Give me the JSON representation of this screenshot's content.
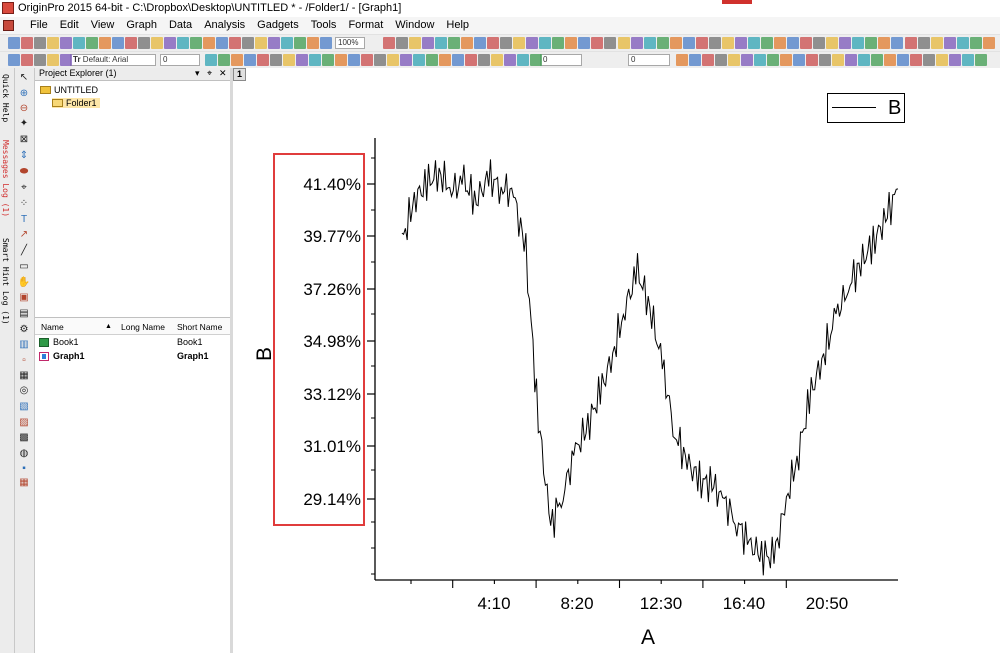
{
  "titlebar": {
    "title": "OriginPro 2015 64-bit - C:\\Dropbox\\Desktop\\UNTITLED * - /Folder1/ - [Graph1]"
  },
  "menu": [
    "File",
    "Edit",
    "View",
    "Graph",
    "Data",
    "Analysis",
    "Gadgets",
    "Tools",
    "Format",
    "Window",
    "Help"
  ],
  "toolbar": {
    "zoom": "100%",
    "font_name": "Default: Arial",
    "font_size": "0",
    "line_width": "0",
    "border_width": "0",
    "pattern_width": "0"
  },
  "left_rail": {
    "quick_help": "Quick Help",
    "messages_log": "Messages Log (1)",
    "smart_hint_log": "Smart Hint Log (1)"
  },
  "project_explorer": {
    "title": "Project Explorer (1)",
    "pin": "▾",
    "pin2": "⌖",
    "close": "✕",
    "root": "UNTITLED",
    "folder": "Folder1",
    "columns": [
      "Name",
      "Long Name",
      "Short Name"
    ],
    "sort_glyph": "▲",
    "items": [
      {
        "name": "Book1",
        "short": "Book1",
        "type": "book"
      },
      {
        "name": "Graph1",
        "short": "Graph1",
        "type": "graph"
      }
    ]
  },
  "graph_window": {
    "layer": "1",
    "legend_label": "B"
  },
  "chart_data": {
    "type": "line",
    "xlabel": "A",
    "ylabel": "B",
    "x_tick_labels": [
      "4:10",
      "8:20",
      "12:30",
      "16:40",
      "20:50"
    ],
    "y_tick_labels": [
      "41.40%",
      "39.77%",
      "37.26%",
      "34.98%",
      "33.12%",
      "31.01%",
      "29.14%"
    ],
    "series": [
      {
        "name": "B",
        "color": "#000000",
        "x": [
          0,
          0.6,
          1.2,
          1.8,
          2.4,
          3.0,
          3.6,
          4.2,
          4.8,
          5.4,
          6.0,
          6.6,
          7.2,
          7.8,
          8.4,
          9.0,
          9.6,
          10.2,
          10.8,
          11.4,
          12.0,
          12.6,
          13.2,
          13.8,
          14.4,
          15.0,
          15.6,
          16.2,
          16.8,
          17.4,
          18.0,
          18.6,
          19.2,
          19.8,
          20.4,
          21.0,
          21.6,
          22.2,
          22.8,
          23.4,
          24.0
        ],
        "y": [
          38.6,
          40.2,
          40.8,
          41.2,
          40.6,
          40.8,
          40.2,
          41.0,
          40.7,
          40.4,
          38.2,
          32.0,
          28.0,
          29.3,
          30.8,
          31.8,
          33.0,
          34.4,
          36.2,
          37.5,
          36.2,
          34.0,
          31.5,
          30.4,
          29.7,
          29.6,
          28.9,
          28.2,
          27.3,
          27.0,
          26.8,
          29.0,
          30.8,
          33.0,
          34.4,
          35.8,
          37.0,
          37.8,
          38.6,
          39.5,
          40.6
        ]
      }
    ]
  }
}
